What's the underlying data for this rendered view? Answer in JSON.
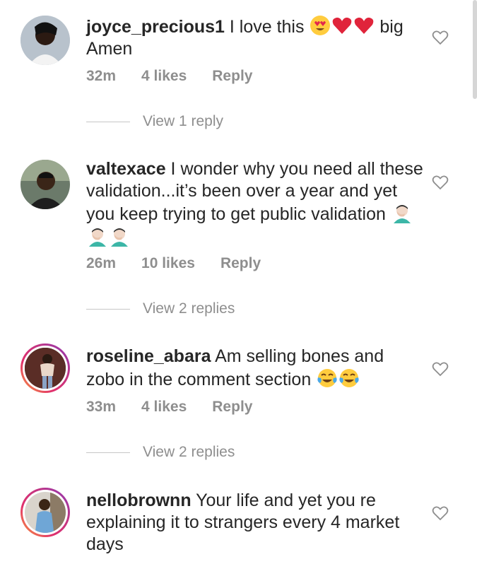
{
  "comments": [
    {
      "username": "joyce_precious1",
      "text": " I love this ",
      "text_after": " big Amen",
      "emojis": [
        "heart-eyes-emoji",
        "red-heart-emoji",
        "red-heart-emoji"
      ],
      "time": "32m",
      "likes": "4 likes",
      "reply": "Reply",
      "view_replies": "View 1 reply"
    },
    {
      "username": "valtexace",
      "text": " I wonder why you need all these validation...it’s been over a year and yet you keep trying to get public validation ",
      "emojis": [
        "facepalm-emoji",
        "facepalm-emoji",
        "facepalm-emoji"
      ],
      "time": "26m",
      "likes": "10 likes",
      "reply": "Reply",
      "view_replies": "View 2 replies"
    },
    {
      "username": "roseline_abara",
      "text": " Am selling bones and zobo in the comment section ",
      "emojis": [
        "tears-of-joy-emoji",
        "tears-of-joy-emoji"
      ],
      "time": "33m",
      "likes": "4 likes",
      "reply": "Reply",
      "view_replies": "View 2 replies"
    },
    {
      "username": "nellobrownn",
      "text": " Your life and yet you re explaining it to strangers every 4 market days"
    }
  ],
  "colors": {
    "text": "#262626",
    "meta": "#8e8e8e",
    "heart_outline": "#8e8e8e"
  }
}
